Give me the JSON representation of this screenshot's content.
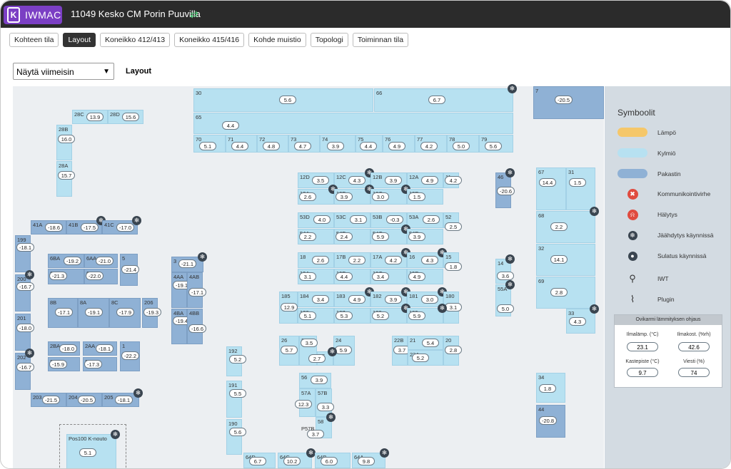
{
  "app": {
    "logo_text": "IWMAC",
    "site_title": "11049 Kesko CM Porin Puuvilla",
    "sync_icon": "sync-icon"
  },
  "tabs": [
    "Kohteen tila",
    "Layout",
    "Koneikko 412/413",
    "Koneikko 415/416",
    "Kohde muistio",
    "Topologi",
    "Toiminnan tila"
  ],
  "view": {
    "select_value": "Näytä viimeisin",
    "layout_label": "Layout"
  },
  "rooms": [
    {
      "id": "30",
      "value": "5.6"
    },
    {
      "id": "66",
      "value": "6.7"
    },
    {
      "id": "7",
      "value": "-20.5"
    },
    {
      "id": "65",
      "value": "4.4"
    },
    {
      "id": "70",
      "value": "5.1"
    },
    {
      "id": "71",
      "value": "4.4"
    },
    {
      "id": "72",
      "value": "4.8"
    },
    {
      "id": "73",
      "value": "4.7"
    },
    {
      "id": "74",
      "value": "3.9"
    },
    {
      "id": "75",
      "value": "4.4"
    },
    {
      "id": "76",
      "value": "4.9"
    },
    {
      "id": "77",
      "value": "4.2"
    },
    {
      "id": "78",
      "value": "5.0"
    },
    {
      "id": "79",
      "value": "5.6"
    },
    {
      "id": "28C",
      "value": "13.9"
    },
    {
      "id": "28D",
      "value": "15.6"
    },
    {
      "id": "28B",
      "value": "16.0"
    },
    {
      "id": "28A",
      "value": "15.7"
    },
    {
      "id": "12D",
      "value": "3.5"
    },
    {
      "id": "12C",
      "value": "4.3"
    },
    {
      "id": "12B",
      "value": "3.9"
    },
    {
      "id": "12A",
      "value": "4.9"
    },
    {
      "id": "11",
      "value": "4.2"
    },
    {
      "id": "13A",
      "value": "2.6"
    },
    {
      "id": "13B",
      "value": "3.9"
    },
    {
      "id": "13C",
      "value": "3.0"
    },
    {
      "id": "13D",
      "value": "1.5"
    },
    {
      "id": "46",
      "value": "-20.6"
    },
    {
      "id": "67",
      "value": "14.4"
    },
    {
      "id": "31",
      "value": "1.5"
    },
    {
      "id": "41A",
      "value": "-18.6"
    },
    {
      "id": "41B",
      "value": "-17.5"
    },
    {
      "id": "41C",
      "value": "-17.0"
    },
    {
      "id": "53D",
      "value": "4.0"
    },
    {
      "id": "53C",
      "value": "3.1"
    },
    {
      "id": "53B",
      "value": "-0.3"
    },
    {
      "id": "53A",
      "value": "2.6"
    },
    {
      "id": "52",
      "value": "2.5"
    },
    {
      "id": "54A",
      "value": "2.2"
    },
    {
      "id": "54B",
      "value": "2.4"
    },
    {
      "id": "54C",
      "value": "5.9"
    },
    {
      "id": "54D",
      "value": "3.9"
    },
    {
      "id": "68",
      "value": "2.2"
    },
    {
      "id": "199",
      "value": "-18.1"
    },
    {
      "id": "6BA",
      "value": "-19.2"
    },
    {
      "id": "6AA",
      "value": "-21.0"
    },
    {
      "id": "5",
      "value": "-21.4"
    },
    {
      "id": "6BB",
      "value": "-21.3"
    },
    {
      "id": "6AB",
      "value": "-22.0"
    },
    {
      "id": "3",
      "value": "-21.1"
    },
    {
      "id": "4AA",
      "value": "-19.1"
    },
    {
      "id": "4AB",
      "value": "-17.1"
    },
    {
      "id": "18",
      "value": "2.6"
    },
    {
      "id": "17B",
      "value": "2.2"
    },
    {
      "id": "17A",
      "value": "4.2"
    },
    {
      "id": "16",
      "value": "4.3"
    },
    {
      "id": "15",
      "value": "1.8"
    },
    {
      "id": "19A",
      "value": "3.1"
    },
    {
      "id": "19B",
      "value": "4.4"
    },
    {
      "id": "19C",
      "value": "3.4"
    },
    {
      "id": "19D",
      "value": "4.9"
    },
    {
      "id": "32",
      "value": "14.1"
    },
    {
      "id": "14",
      "value": "3.6"
    },
    {
      "id": "200",
      "value": "-16.7"
    },
    {
      "id": "185",
      "value": "12.9"
    },
    {
      "id": "184",
      "value": "3.4"
    },
    {
      "id": "183",
      "value": "4.9"
    },
    {
      "id": "182",
      "value": "3.9"
    },
    {
      "id": "181",
      "value": "3.0"
    },
    {
      "id": "180",
      "value": "3.1"
    },
    {
      "id": "186",
      "value": "5.1"
    },
    {
      "id": "187",
      "value": "5.3"
    },
    {
      "id": "188",
      "value": "5.2"
    },
    {
      "id": "189",
      "value": "5.9"
    },
    {
      "id": "69",
      "value": "2.8"
    },
    {
      "id": "55A",
      "value": "5.0"
    },
    {
      "id": "8B",
      "value": "-17.1"
    },
    {
      "id": "8A",
      "value": "-19.1"
    },
    {
      "id": "8C",
      "value": "-17.9"
    },
    {
      "id": "206",
      "value": "-19.3"
    },
    {
      "id": "4BA",
      "value": "-19.4"
    },
    {
      "id": "4BB",
      "value": "-16.6"
    },
    {
      "id": "201",
      "value": "-18.0"
    },
    {
      "id": "33",
      "value": "4.3"
    },
    {
      "id": "26",
      "value": "5.7"
    },
    {
      "id": "23",
      "value": "3.5"
    },
    {
      "id": "24",
      "value": "5.9"
    },
    {
      "id": "25",
      "value": "2.7"
    },
    {
      "id": "22B",
      "value": "3.7"
    },
    {
      "id": "21",
      "value": "5.4"
    },
    {
      "id": "20",
      "value": "2.8"
    },
    {
      "id": "22A",
      "value": "5.2"
    },
    {
      "id": "2BA",
      "value": "-18.0"
    },
    {
      "id": "2AA",
      "value": "-18.1"
    },
    {
      "id": "1",
      "value": "-22.2"
    },
    {
      "id": "2BB",
      "value": "-15.9"
    },
    {
      "id": "2AB",
      "value": "-17.3"
    },
    {
      "id": "192",
      "value": "5.2"
    },
    {
      "id": "202",
      "value": "-16.7"
    },
    {
      "id": "56",
      "value": "3.9"
    },
    {
      "id": "57A",
      "value": "12.3"
    },
    {
      "id": "57B",
      "value": "3.3"
    },
    {
      "id": "34",
      "value": "1.8"
    },
    {
      "id": "203",
      "value": "-21.5"
    },
    {
      "id": "204",
      "value": "-20.5"
    },
    {
      "id": "205",
      "value": "-18.1"
    },
    {
      "id": "191",
      "value": "5.5"
    },
    {
      "id": "58",
      "value": "3.7"
    },
    {
      "id": "44",
      "value": "-20.8"
    },
    {
      "id": "190",
      "value": "5.6"
    },
    {
      "id": "Pos100 K-nouto",
      "value": "5.1"
    },
    {
      "id": "64D",
      "value": "6.7"
    },
    {
      "id": "64C",
      "value": "10.2"
    },
    {
      "id": "64B",
      "value": "6.0"
    },
    {
      "id": "64A",
      "value": "9.8"
    }
  ],
  "labels": {
    "p57b": "P57B"
  },
  "legend": {
    "title": "Symboolit",
    "items": [
      {
        "label": "Lämpö",
        "color": "#f5c76a",
        "icon": "swatch"
      },
      {
        "label": "Kylmiö",
        "color": "#b7e1f1",
        "icon": "swatch"
      },
      {
        "label": "Pakastin",
        "color": "#8fb1d5",
        "icon": "swatch"
      },
      {
        "label": "Kommunikointivirhe",
        "icon": "communication-error-icon"
      },
      {
        "label": "Hälytys",
        "icon": "alarm-bell-icon"
      },
      {
        "label": "Jäähdytys käynnissä",
        "icon": "cooling-snowflake-icon"
      },
      {
        "label": "Sulatus käynnissä",
        "icon": "defrost-icon"
      },
      {
        "label": "IWT",
        "icon": "iwt-icon"
      },
      {
        "label": "Plugin",
        "icon": "plugin-icon"
      }
    ]
  },
  "heating_panel": {
    "title": "Ovikarmi lämmityksen ohjaus",
    "fields": [
      {
        "label": "Ilmalämp. (°C)",
        "value": "23.1"
      },
      {
        "label": "Ilmakost. (%rh)",
        "value": "42.6"
      },
      {
        "label": "Kastepiste (°C)",
        "value": "9.7"
      },
      {
        "label": "Viesti (%)",
        "value": "74"
      }
    ]
  },
  "colors": {
    "cooler": "#b7e1f1",
    "freezer": "#8fb1d5",
    "heat": "#f5c76a",
    "logo": "#7b3fc4"
  }
}
